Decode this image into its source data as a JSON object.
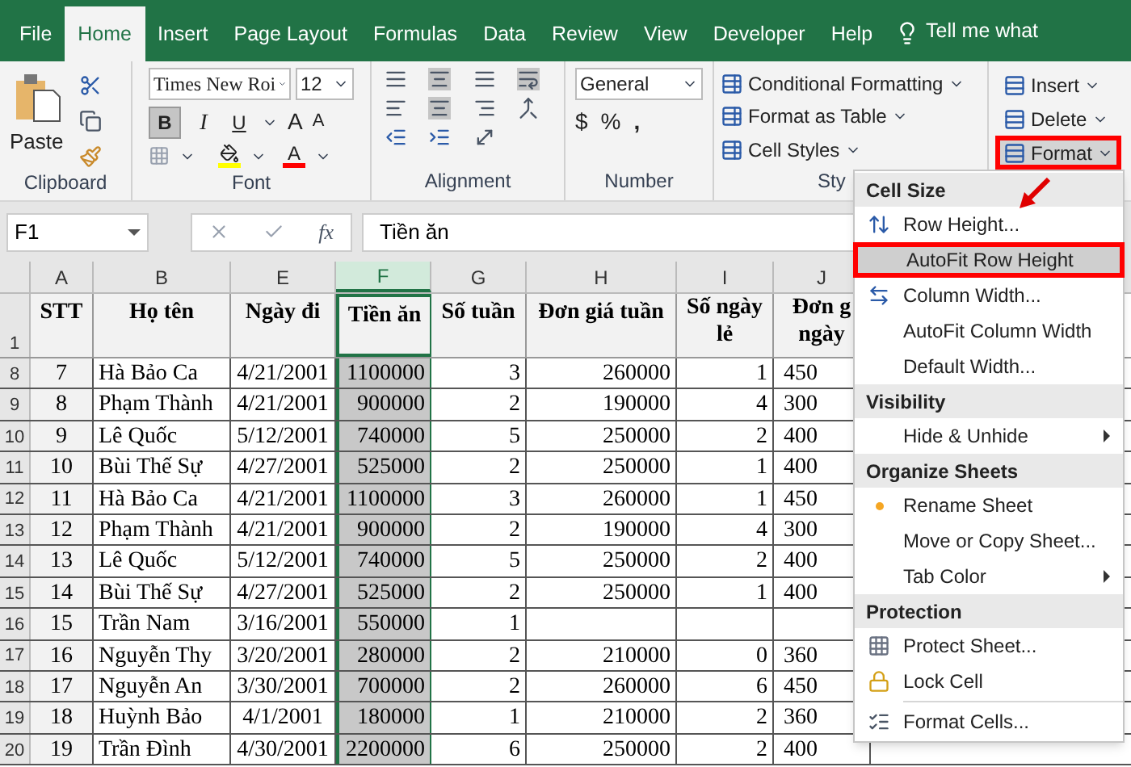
{
  "tabs": [
    {
      "label": "File",
      "selected": false
    },
    {
      "label": "Home",
      "selected": true
    },
    {
      "label": "Insert",
      "selected": false
    },
    {
      "label": "Page Layout",
      "selected": false
    },
    {
      "label": "Formulas",
      "selected": false
    },
    {
      "label": "Data",
      "selected": false
    },
    {
      "label": "Review",
      "selected": false
    },
    {
      "label": "View",
      "selected": false
    },
    {
      "label": "Developer",
      "selected": false
    },
    {
      "label": "Help",
      "selected": false
    }
  ],
  "tell_me": "Tell me what",
  "ribbon": {
    "clipboard": {
      "paste": "Paste",
      "label": "Clipboard"
    },
    "font": {
      "name": "Times New Roi",
      "size": "12",
      "bold": {
        "text": "B",
        "selected": true
      },
      "italic": "I",
      "underline": "U",
      "grow": "A",
      "shrink": "A",
      "color_letter": "A",
      "label": "Font"
    },
    "alignment": {
      "label": "Alignment"
    },
    "number": {
      "format": "General",
      "currency": "$",
      "percent": "%",
      "comma": ",",
      "label": "Number"
    },
    "styles": {
      "items": [
        "Conditional Formatting",
        "Format as Table",
        "Cell Styles"
      ],
      "label": "Sty"
    },
    "cells": {
      "items": [
        {
          "label": "Insert",
          "highlighted": false
        },
        {
          "label": "Delete",
          "highlighted": false
        },
        {
          "label": "Format",
          "highlighted": true
        }
      ]
    }
  },
  "formula_bar": {
    "name_box": "F1",
    "fx": "fx",
    "value": "Tiền ăn"
  },
  "columns": [
    {
      "letter": "A",
      "selected": false
    },
    {
      "letter": "B",
      "selected": false
    },
    {
      "letter": "E",
      "selected": false
    },
    {
      "letter": "F",
      "selected": true
    },
    {
      "letter": "G",
      "selected": false
    },
    {
      "letter": "H",
      "selected": false
    },
    {
      "letter": "I",
      "selected": false
    },
    {
      "letter": "J",
      "selected": false
    }
  ],
  "header_row": {
    "number": "1",
    "cells": [
      [
        "STT"
      ],
      [
        "Họ tên"
      ],
      [
        "Ngày đi"
      ],
      [
        "Tiền ăn"
      ],
      [
        "Số tuần"
      ],
      [
        "Đơn giá tuần"
      ],
      [
        "Số ngày",
        "lẻ"
      ],
      [
        "Đơn g",
        "ngày"
      ]
    ]
  },
  "rows": [
    {
      "number": "8",
      "cells": [
        "7",
        "Hà Bảo Ca",
        "4/21/2001",
        "1100000",
        "3",
        "260000",
        "1",
        "450"
      ]
    },
    {
      "number": "9",
      "cells": [
        "8",
        "Phạm Thành",
        "4/21/2001",
        "900000",
        "2",
        "190000",
        "4",
        "300"
      ]
    },
    {
      "number": "10",
      "cells": [
        "9",
        "Lê Quốc",
        "5/12/2001",
        "740000",
        "5",
        "250000",
        "2",
        "400"
      ]
    },
    {
      "number": "11",
      "cells": [
        "10",
        "Bùi Thế Sự",
        "4/27/2001",
        "525000",
        "2",
        "250000",
        "1",
        "400"
      ]
    },
    {
      "number": "12",
      "cells": [
        "11",
        "Hà Bảo Ca",
        "4/21/2001",
        "1100000",
        "3",
        "260000",
        "1",
        "450"
      ]
    },
    {
      "number": "13",
      "cells": [
        "12",
        "Phạm Thành",
        "4/21/2001",
        "900000",
        "2",
        "190000",
        "4",
        "300"
      ]
    },
    {
      "number": "14",
      "cells": [
        "13",
        "Lê Quốc",
        "5/12/2001",
        "740000",
        "5",
        "250000",
        "2",
        "400"
      ]
    },
    {
      "number": "15",
      "cells": [
        "14",
        "Bùi Thế Sự",
        "4/27/2001",
        "525000",
        "2",
        "250000",
        "1",
        "400"
      ]
    },
    {
      "number": "16",
      "cells": [
        "15",
        "Trần Nam",
        "3/16/2001",
        "550000",
        "1",
        null,
        null,
        null
      ]
    },
    {
      "number": "17",
      "cells": [
        "16",
        "Nguyễn Thy",
        "3/20/2001",
        "280000",
        "2",
        "210000",
        "0",
        "360"
      ]
    },
    {
      "number": "18",
      "cells": [
        "17",
        "Nguyễn An",
        "3/30/2001",
        "700000",
        "2",
        "260000",
        "6",
        "450"
      ]
    },
    {
      "number": "19",
      "cells": [
        "18",
        "Huỳnh Bảo",
        "4/1/2001",
        "180000",
        "1",
        "210000",
        "2",
        "360"
      ]
    },
    {
      "number": "20",
      "cells": [
        "19",
        "Trần Đình",
        "4/30/2001",
        "2200000",
        "6",
        "250000",
        "2",
        "400"
      ]
    }
  ],
  "menu": [
    {
      "kind": "header",
      "label": "Cell Size"
    },
    {
      "kind": "item",
      "label": "Row Height...",
      "highlighted": false,
      "submenu": false,
      "marked": false
    },
    {
      "kind": "item",
      "label": "AutoFit Row Height",
      "highlighted": true,
      "submenu": false,
      "marked": false
    },
    {
      "kind": "item",
      "label": "Column Width...",
      "highlighted": false,
      "submenu": false,
      "marked": false
    },
    {
      "kind": "item",
      "label": "AutoFit Column Width",
      "highlighted": false,
      "submenu": false,
      "marked": false
    },
    {
      "kind": "item",
      "label": "Default Width...",
      "highlighted": false,
      "submenu": false,
      "marked": false
    },
    {
      "kind": "header",
      "label": "Visibility"
    },
    {
      "kind": "item",
      "label": "Hide & Unhide",
      "highlighted": false,
      "submenu": true,
      "marked": false
    },
    {
      "kind": "header",
      "label": "Organize Sheets"
    },
    {
      "kind": "item",
      "label": "Rename Sheet",
      "highlighted": false,
      "submenu": false,
      "marked": true
    },
    {
      "kind": "item",
      "label": "Move or Copy Sheet...",
      "highlighted": false,
      "submenu": false,
      "marked": false
    },
    {
      "kind": "item",
      "label": "Tab Color",
      "highlighted": false,
      "submenu": true,
      "marked": false
    },
    {
      "kind": "header",
      "label": "Protection"
    },
    {
      "kind": "item",
      "label": "Protect Sheet...",
      "highlighted": false,
      "submenu": false,
      "marked": false
    },
    {
      "kind": "item",
      "label": "Lock Cell",
      "highlighted": false,
      "submenu": false,
      "marked": false
    },
    {
      "kind": "separator"
    },
    {
      "kind": "item",
      "label": "Format Cells...",
      "highlighted": false,
      "submenu": false,
      "marked": false
    }
  ]
}
